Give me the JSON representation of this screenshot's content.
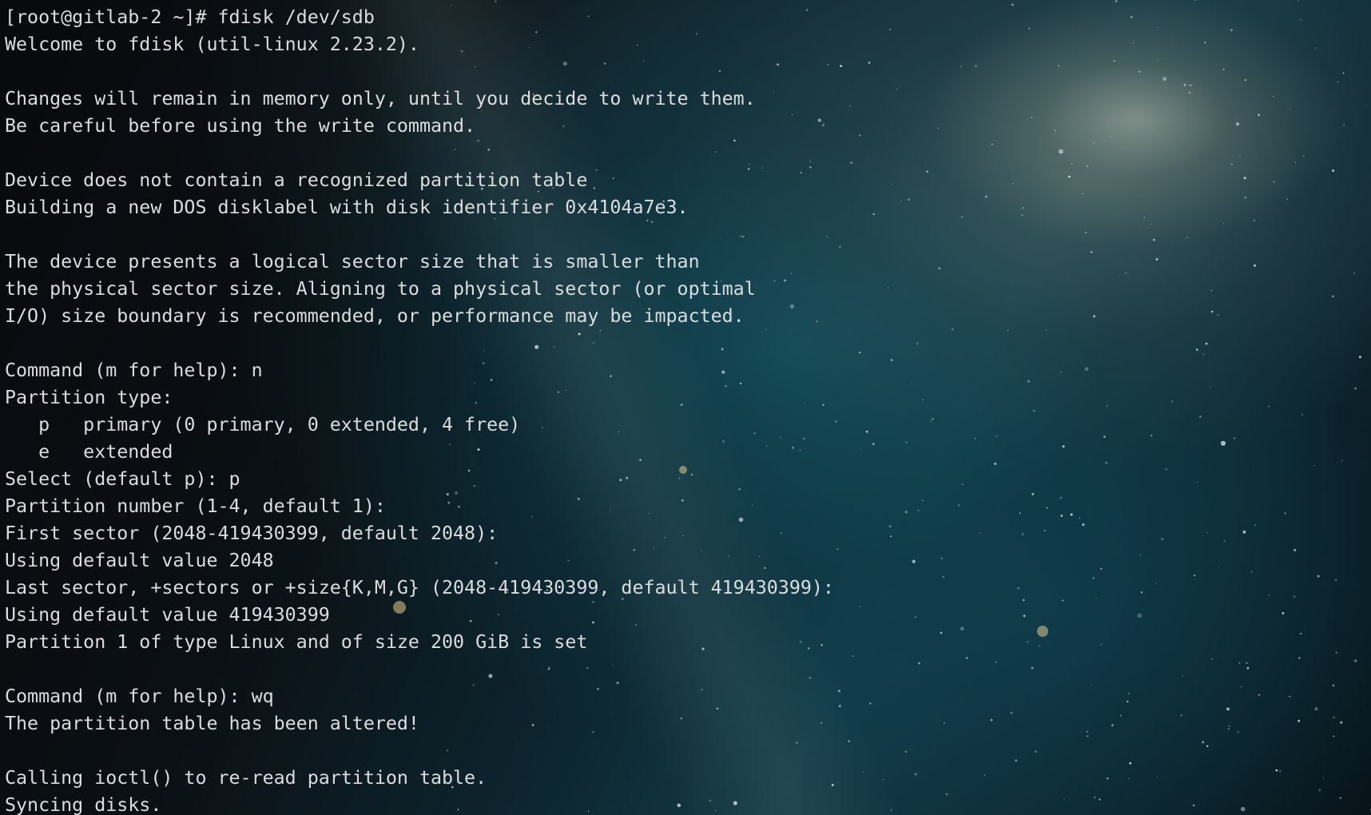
{
  "terminal": {
    "lines": [
      "[root@gitlab-2 ~]# fdisk /dev/sdb",
      "Welcome to fdisk (util-linux 2.23.2).",
      "",
      "Changes will remain in memory only, until you decide to write them.",
      "Be careful before using the write command.",
      "",
      "Device does not contain a recognized partition table",
      "Building a new DOS disklabel with disk identifier 0x4104a7e3.",
      "",
      "The device presents a logical sector size that is smaller than",
      "the physical sector size. Aligning to a physical sector (or optimal",
      "I/O) size boundary is recommended, or performance may be impacted.",
      "",
      "Command (m for help): n",
      "Partition type:",
      "   p   primary (0 primary, 0 extended, 4 free)",
      "   e   extended",
      "Select (default p): p",
      "Partition number (1-4, default 1):",
      "First sector (2048-419430399, default 2048):",
      "Using default value 2048",
      "Last sector, +sectors or +size{K,M,G} (2048-419430399, default 419430399):",
      "Using default value 419430399",
      "Partition 1 of type Linux and of size 200 GiB is set",
      "",
      "Command (m for help): wq",
      "The partition table has been altered!",
      "",
      "Calling ioctl() to re-read partition table.",
      "Syncing disks."
    ]
  },
  "colors": {
    "text": "#d9dde0",
    "background": "#05090c"
  }
}
